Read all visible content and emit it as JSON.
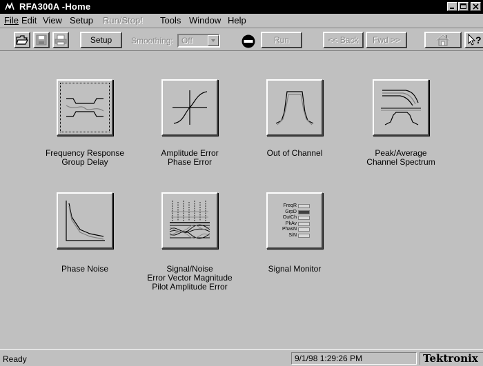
{
  "window": {
    "title": "RFA300A -Home"
  },
  "menus": [
    {
      "label": "File",
      "enabled": true
    },
    {
      "label": "Edit",
      "enabled": true
    },
    {
      "label": "View",
      "enabled": true
    },
    {
      "label": "Setup",
      "enabled": true
    },
    {
      "label": "Run/Stop!",
      "enabled": false
    },
    {
      "label": "Tools",
      "enabled": true
    },
    {
      "label": "Window",
      "enabled": true
    },
    {
      "label": "Help",
      "enabled": true
    }
  ],
  "toolbar": {
    "setup_label": "Setup",
    "smoothing_label": "Smoothing:",
    "smoothing_value": "Off",
    "run_label": "Run",
    "back_label": "<< Back",
    "fwd_label": "Fwd >>"
  },
  "tiles": [
    {
      "lines": [
        "Frequency Response",
        "Group Delay"
      ],
      "selected": true,
      "icon": "frequency-response-icon"
    },
    {
      "lines": [
        "Amplitude Error",
        "Phase Error"
      ],
      "selected": false,
      "icon": "amplitude-error-icon"
    },
    {
      "lines": [
        "Out of Channel"
      ],
      "selected": false,
      "icon": "out-of-channel-icon"
    },
    {
      "lines": [
        "Peak/Average",
        "Channel Spectrum"
      ],
      "selected": false,
      "icon": "peak-average-icon"
    },
    {
      "lines": [
        "Phase Noise"
      ],
      "selected": false,
      "icon": "phase-noise-icon"
    },
    {
      "lines": [
        "Signal/Noise",
        "Error Vector Magnitude",
        "Pilot Amplitude Error"
      ],
      "selected": false,
      "icon": "signal-noise-icon"
    },
    {
      "lines": [
        "Signal Monitor"
      ],
      "selected": false,
      "icon": "signal-monitor-icon"
    }
  ],
  "signal_monitor": {
    "labels": [
      "FreqR",
      "GrpD",
      "OutCh",
      "PkAv",
      "PhasN",
      "S/N"
    ],
    "active_index": 1
  },
  "status": {
    "text": "Ready",
    "timestamp": "9/1/98 1:29:26 PM",
    "brand": "Tektronix"
  },
  "colors": {
    "titlebar": "#000000",
    "face": "#c0c0c0"
  }
}
